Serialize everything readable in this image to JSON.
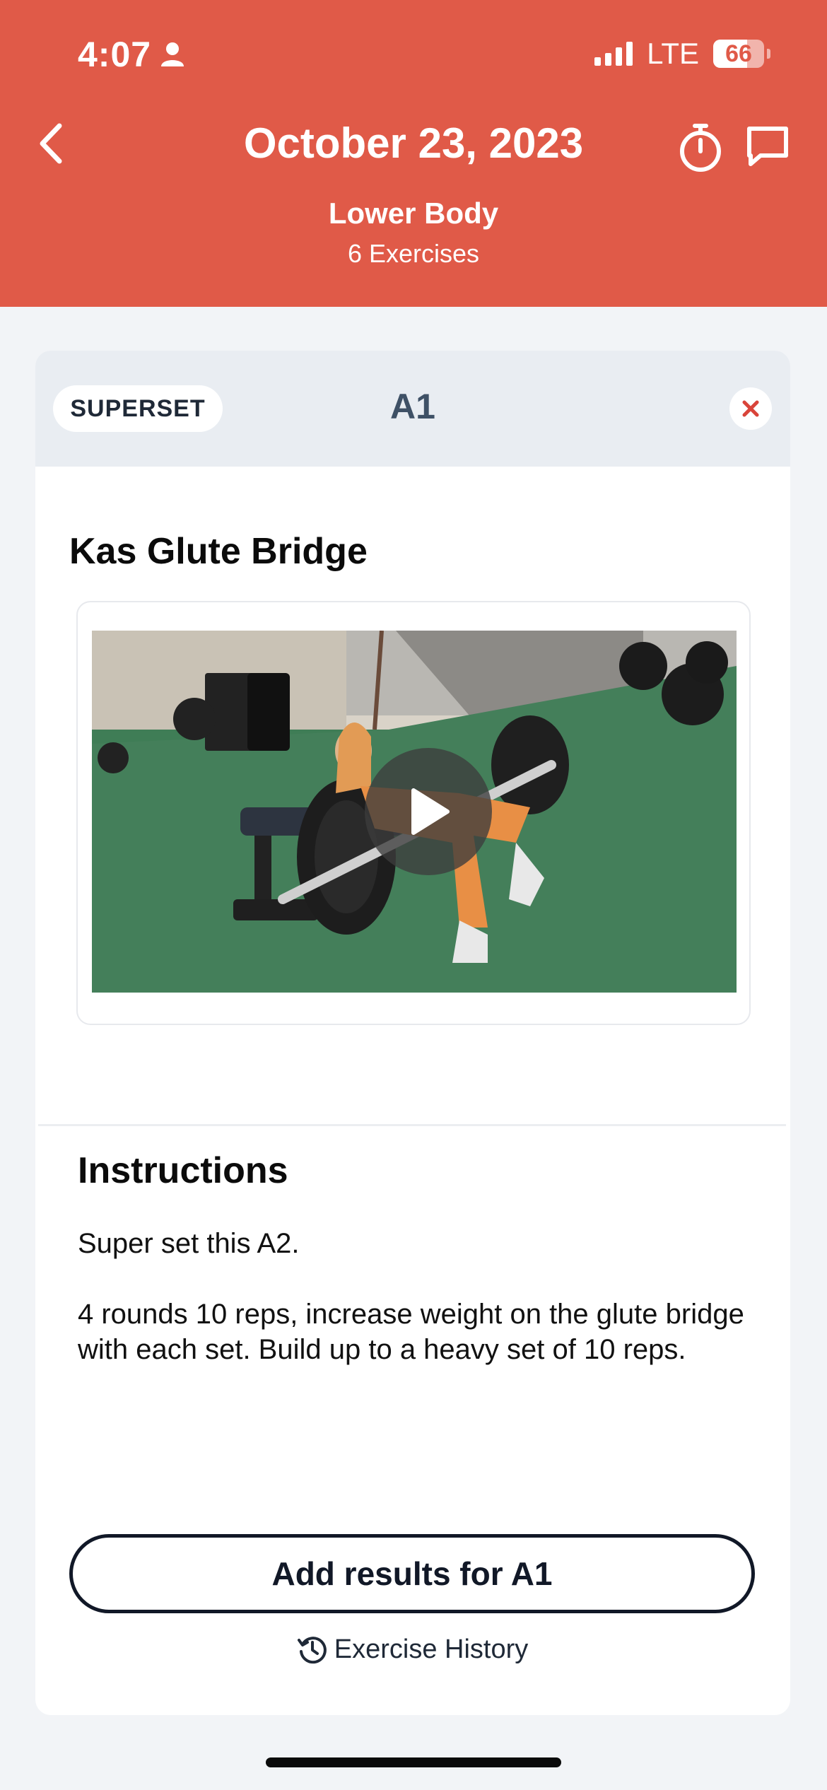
{
  "status_bar": {
    "time": "4:07",
    "network": "LTE",
    "battery": "66"
  },
  "header": {
    "date": "October 23, 2023",
    "workout_name": "Lower Body",
    "exercise_count": "6 Exercises"
  },
  "block": {
    "tag": "SUPERSET",
    "label": "A1",
    "exercise_name": "Kas Glute Bridge"
  },
  "instructions": {
    "heading": "Instructions",
    "text": "Super set this A2.\n\n4 rounds 10 reps,  increase weight on the glute bridge with each set. Build up to a heavy set of 10 reps."
  },
  "actions": {
    "add_results": "Add results for A1",
    "history": "Exercise History"
  },
  "colors": {
    "header_bg": "#e05a48",
    "close_icon": "#d9443a"
  },
  "icons": [
    "person-icon",
    "signal-icon",
    "battery-icon",
    "back-chevron-icon",
    "stopwatch-icon",
    "chat-bubble-icon",
    "close-x-icon",
    "play-icon",
    "history-icon"
  ]
}
